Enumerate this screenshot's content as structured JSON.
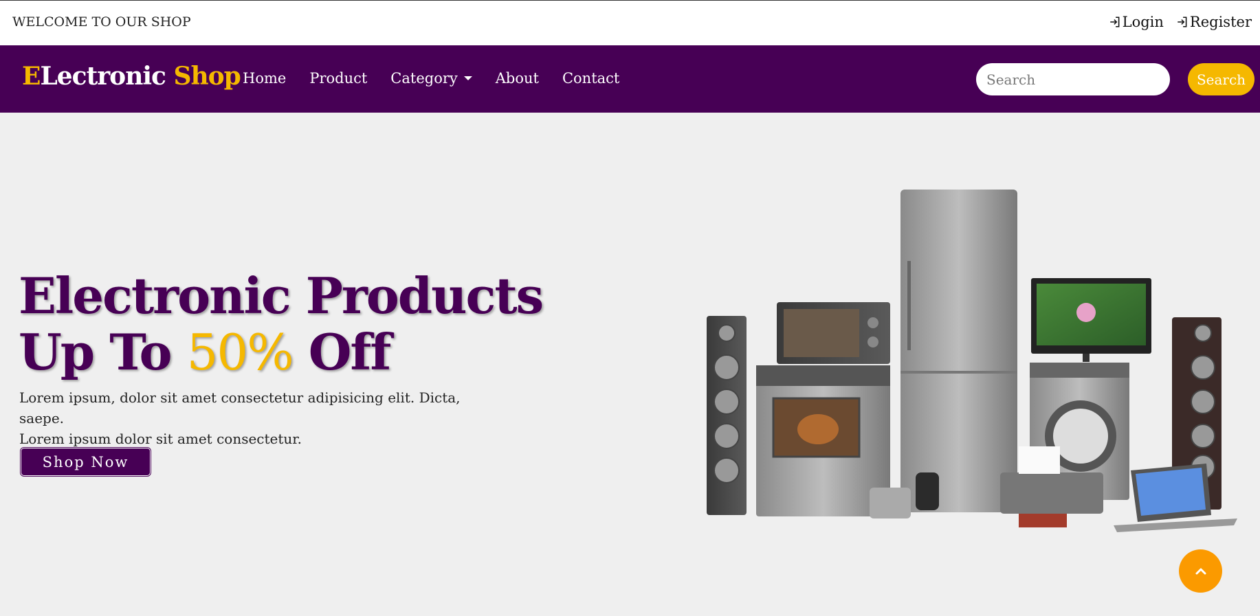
{
  "topbar": {
    "welcome": "WELCOME TO OUR SHOP",
    "login_label": "Login",
    "register_label": "Register"
  },
  "navbar": {
    "brand": {
      "part1": "E",
      "part2": "Lectronic ",
      "part3": "Shop"
    },
    "links": [
      {
        "label": "Home"
      },
      {
        "label": "Product"
      },
      {
        "label": "Category"
      },
      {
        "label": "About"
      },
      {
        "label": "Contact"
      }
    ],
    "search": {
      "placeholder": "Search",
      "button_label": "Search"
    }
  },
  "hero": {
    "title_line1": "Electronic Products",
    "title_line2_pre": "Up To ",
    "title_line2_accent": "50%",
    "title_line2_post": " Off",
    "description_line1": "Lorem ipsum, dolor sit amet consectetur adipisicing elit. Dicta, saepe.",
    "description_line2": "Lorem ipsum dolor sit amet consectetur.",
    "button_label": "Shop Now"
  },
  "colors": {
    "brand_purple": "#470055",
    "accent_yellow": "#f5b800",
    "scroll_button": "#fb9a00"
  },
  "icons": {
    "login": "login-icon",
    "register": "login-icon",
    "category_dropdown": "caret-down-icon",
    "scroll_top": "chevron-up-icon"
  }
}
